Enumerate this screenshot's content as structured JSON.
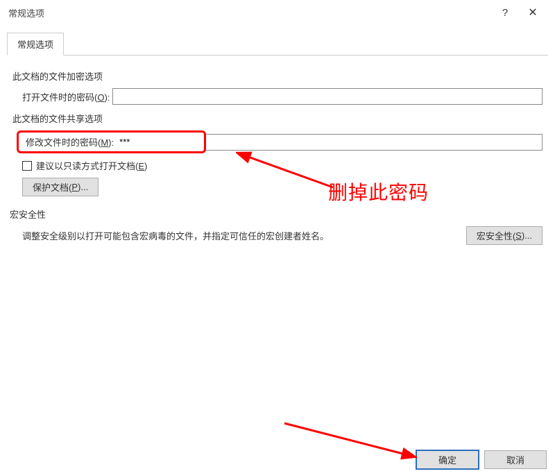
{
  "titlebar": {
    "title": "常规选项",
    "help": "?",
    "close": "✕"
  },
  "tab": {
    "label": "常规选项"
  },
  "section_encrypt": "此文档的文件加密选项",
  "open_password_label": "打开文件时的密码(",
  "open_password_key": "O",
  "open_password_suffix": "):",
  "open_password_value": "",
  "section_share": "此文档的文件共享选项",
  "modify_password_label": "修改文件时的密码(",
  "modify_password_key": "M",
  "modify_password_suffix": "):",
  "modify_password_value": "***",
  "readonly_label": "建议以只读方式打开文档(",
  "readonly_key": "E",
  "readonly_suffix": ")",
  "protect_btn_label": "保护文档(",
  "protect_btn_key": "P",
  "protect_btn_suffix": ")...",
  "section_macro": "宏安全性",
  "macro_text": "调整安全级别以打开可能包含宏病毒的文件，并指定可信任的宏创建者姓名。",
  "macro_btn_label": "宏安全性(",
  "macro_btn_key": "S",
  "macro_btn_suffix": ")...",
  "footer": {
    "ok": "确定",
    "cancel": "取消"
  },
  "annotation": {
    "text": "删掉此密码"
  },
  "colors": {
    "red": "#ff0000",
    "highlight_blue": "#2a6fbb"
  }
}
